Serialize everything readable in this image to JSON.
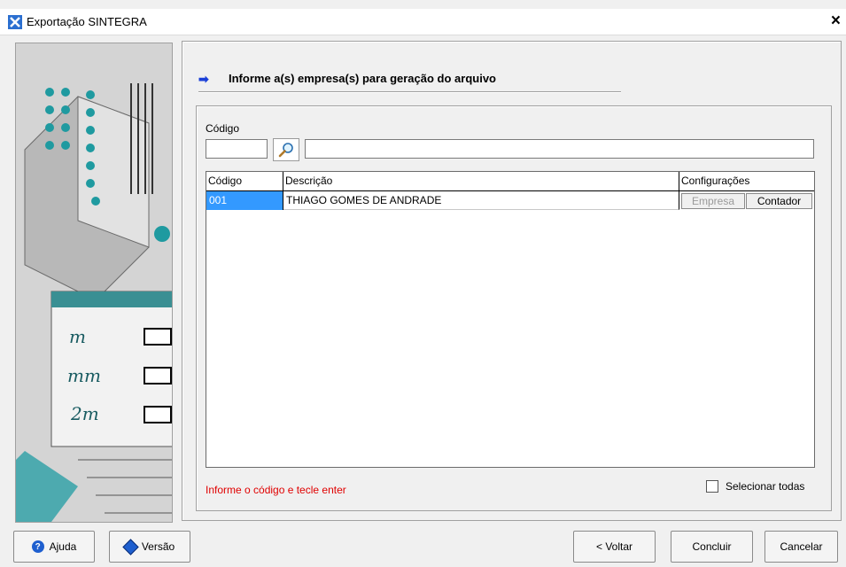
{
  "window": {
    "title": "Exportação SINTEGRA",
    "close_label": "×"
  },
  "heading": {
    "text": "Informe a(s) empresa(s) para geração do arquivo"
  },
  "search": {
    "codigo_label": "Código",
    "codigo_value": "",
    "description_value": ""
  },
  "grid": {
    "headers": [
      "Código",
      "Descrição",
      "Configurações"
    ],
    "rows": [
      {
        "codigo": "001",
        "descricao": "THIAGO GOMES DE ANDRADE",
        "empresa_button": "Empresa",
        "contador_button": "Contador"
      }
    ]
  },
  "hint": "Informe o código e tecle enter",
  "select_all": {
    "label": "Selecionar todas",
    "checked": false
  },
  "buttons": {
    "ajuda": "Ajuda",
    "versao": "Versão",
    "voltar": "< Voltar",
    "concluir": "Concluir",
    "cancelar": "Cancelar"
  },
  "colors": {
    "selection": "#3399ff",
    "hint": "#e00000",
    "accent": "#1a3fd8"
  },
  "icons": [
    "app-icon",
    "search-icon",
    "arrow-right-icon",
    "help-icon",
    "version-icon"
  ]
}
